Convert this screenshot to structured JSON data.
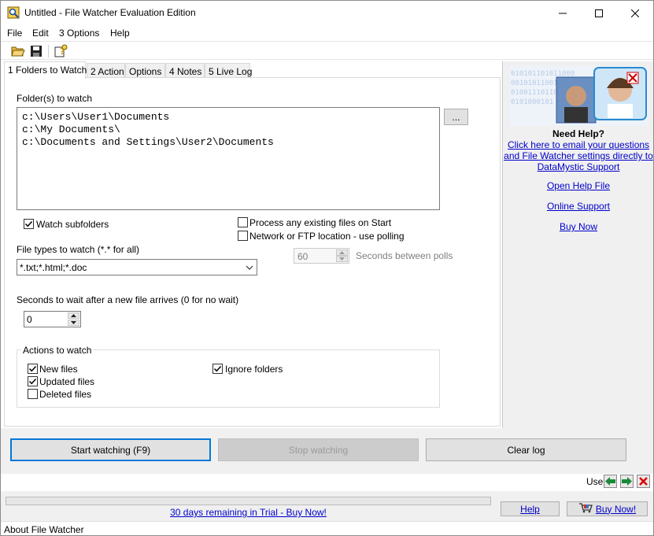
{
  "window": {
    "title": "Untitled - File Watcher Evaluation Edition"
  },
  "menu": [
    "File",
    "Edit",
    "3 Options",
    "Help"
  ],
  "tabs": [
    "1 Folders to Watch",
    "2 Action",
    "Options",
    "4 Notes",
    "5 Live Log"
  ],
  "folders": {
    "label": "Folder(s) to watch",
    "lines": [
      "c:\\Users\\User1\\Documents",
      "c:\\My Documents\\",
      "c:\\Documents and Settings\\User2\\Documents"
    ],
    "browse_label": "..."
  },
  "options": {
    "watch_subfolders": {
      "label": "Watch subfolders",
      "checked": true
    },
    "process_existing": {
      "label": "Process any existing files on Start",
      "checked": false
    },
    "network_polling": {
      "label": "Network or FTP location - use polling",
      "checked": false
    }
  },
  "file_types": {
    "label": "File types to watch (*.* for all)",
    "value": "*.txt;*.html;*.doc"
  },
  "polling": {
    "value": "60",
    "label": "Seconds between polls"
  },
  "wait": {
    "label": "Seconds to wait after a new file arrives (0 for no wait)",
    "value": "0"
  },
  "actions": {
    "title": "Actions to watch",
    "new_files": {
      "label": "New files",
      "checked": true
    },
    "updated_files": {
      "label": "Updated files",
      "checked": true
    },
    "deleted_files": {
      "label": "Deleted files",
      "checked": false
    },
    "ignore_folders": {
      "label": "Ignore folders",
      "checked": true
    }
  },
  "buttons": {
    "start": "Start watching (F9)",
    "stop": "Stop watching",
    "clear": "Clear log"
  },
  "help": {
    "title": "Need Help?",
    "email_lines": [
      "Click here to email your questions",
      "and File Watcher settings directly to",
      "DataMystic Support"
    ],
    "open_help": "Open Help File",
    "online_support": "Online Support",
    "buy_now": "Buy Now",
    "binary_lines": [
      "010101101011000",
      "00101011001101",
      "010011101101",
      "0101000101"
    ]
  },
  "nav": {
    "use_label": "Use"
  },
  "trial": {
    "text": "30 days remaining in Trial - Buy Now!",
    "help": "Help",
    "buy": "Buy Now!"
  },
  "status": {
    "text": "About File Watcher"
  },
  "colors": {
    "link": "#0000cc",
    "accent_border": "#0078d7",
    "panel_bg": "#f0f0f0"
  }
}
